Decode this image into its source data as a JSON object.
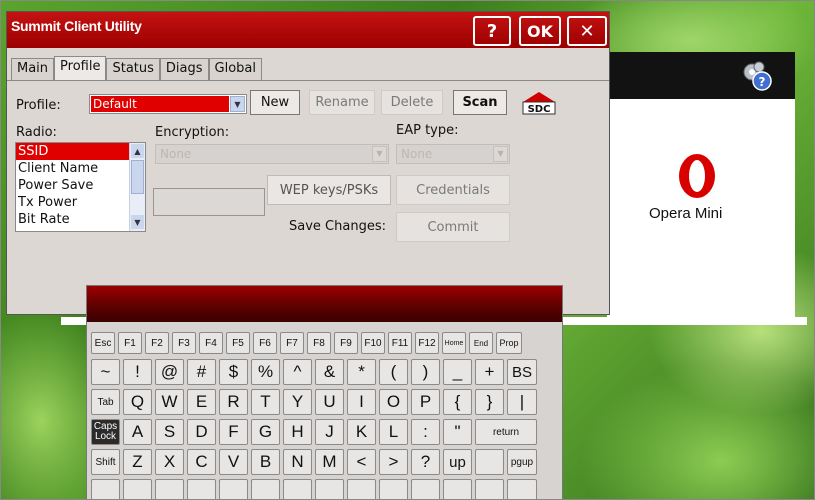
{
  "window": {
    "title": "Summit Client Utility",
    "help_label": "?",
    "ok_label": "OK",
    "close_label": "✕"
  },
  "tabs": [
    "Main",
    "Profile",
    "Status",
    "Diags",
    "Global"
  ],
  "active_tab": "Profile",
  "profile": {
    "label": "Profile:",
    "value": "Default",
    "buttons": {
      "new": "New",
      "rename": "Rename",
      "delete": "Delete",
      "scan": "Scan"
    },
    "logo_text": "SDC"
  },
  "radio": {
    "label": "Radio:",
    "items": [
      "SSID",
      "Client Name",
      "Power Save",
      "Tx Power",
      "Bit Rate"
    ],
    "selected": "SSID"
  },
  "encryption": {
    "label": "Encryption:",
    "value": "None"
  },
  "eap": {
    "label": "EAP type:",
    "value": "None"
  },
  "wep_button": "WEP keys/PSKs",
  "credentials_button": "Credentials",
  "save": {
    "label": "Save Changes:",
    "commit": "Commit"
  },
  "opera": {
    "label": "Opera Mini"
  },
  "keyboard": {
    "rows": [
      [
        "Esc",
        "F1",
        "F2",
        "F3",
        "F4",
        "F5",
        "F6",
        "F7",
        "F8",
        "F9",
        "F10",
        "F11",
        "F12",
        "Home",
        "End",
        "Prop"
      ],
      [
        "~",
        "!",
        "@",
        "#",
        "$",
        "%",
        "^",
        "&",
        "*",
        "(",
        ")",
        "_",
        "+",
        "BS"
      ],
      [
        "Tab",
        "Q",
        "W",
        "E",
        "R",
        "T",
        "Y",
        "U",
        "I",
        "O",
        "P",
        "{",
        "}",
        "|"
      ],
      [
        "Caps Lock",
        "A",
        "S",
        "D",
        "F",
        "G",
        "H",
        "J",
        "K",
        "L",
        ":",
        "\"",
        "return"
      ],
      [
        "Shift",
        "Z",
        "X",
        "C",
        "V",
        "B",
        "N",
        "M",
        "<",
        ">",
        "?",
        "up",
        "",
        "pgup"
      ]
    ]
  },
  "colors": {
    "title_red": "#c51212",
    "selection_red": "#e00000"
  }
}
